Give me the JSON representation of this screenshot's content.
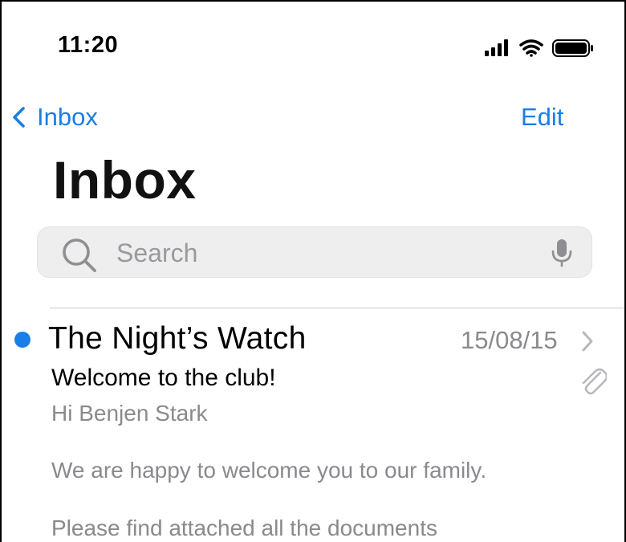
{
  "status_bar": {
    "time": "11:20"
  },
  "nav": {
    "back_label": "Inbox",
    "edit_label": "Edit",
    "title": "Inbox"
  },
  "search": {
    "placeholder": "Search",
    "value": ""
  },
  "messages": [
    {
      "unread": true,
      "sender": "The Night’s Watch",
      "date": "15/08/15",
      "subject": "Welcome to the club!",
      "has_attachment": true,
      "preview_lines": [
        "Hi Benjen Stark",
        "We are happy to welcome you to our family.",
        "Please find attached all the documents"
      ]
    }
  ],
  "colors": {
    "accent": "#1a7ee6",
    "secondary_text": "#8a8a8e",
    "search_bg": "#eeeeef"
  },
  "icons": {
    "signal": "cellular-signal-icon",
    "wifi": "wifi-icon",
    "battery": "battery-icon",
    "back": "chevron-left-icon",
    "search": "search-icon",
    "mic": "microphone-icon",
    "disclosure": "chevron-right-icon",
    "attachment": "paperclip-icon"
  }
}
